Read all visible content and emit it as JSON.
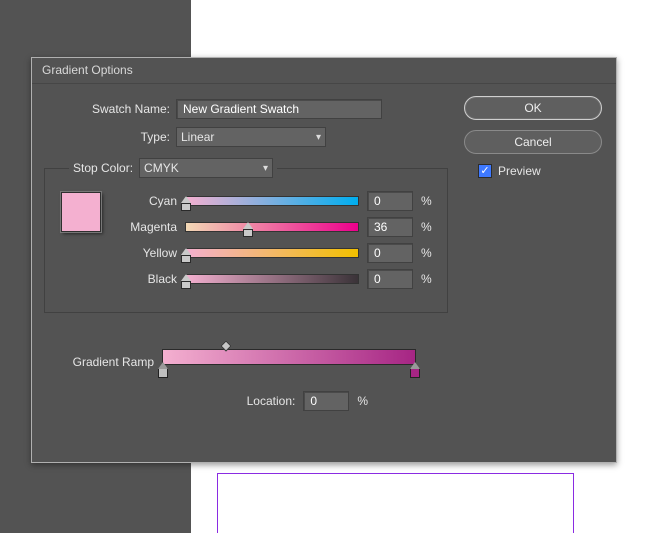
{
  "dialog": {
    "title": "Gradient Options",
    "swatch_name_label": "Swatch Name:",
    "swatch_name_value": "New Gradient Swatch",
    "type_label": "Type:",
    "type_value": "Linear",
    "stop_color_label": "Stop Color:",
    "stop_color_value": "CMYK",
    "sliders": {
      "cyan": {
        "label": "Cyan",
        "value": "0",
        "unit": "%",
        "thumb_pct": 0
      },
      "magenta": {
        "label": "Magenta",
        "value": "36",
        "unit": "%",
        "thumb_pct": 36
      },
      "yellow": {
        "label": "Yellow",
        "value": "0",
        "unit": "%",
        "thumb_pct": 0
      },
      "black": {
        "label": "Black",
        "value": "0",
        "unit": "%",
        "thumb_pct": 0
      }
    },
    "preview_swatch_color": "#f4b0d0",
    "ramp_label": "Gradient Ramp",
    "location_label": "Location:",
    "location_value": "0",
    "location_unit": "%"
  },
  "buttons": {
    "ok": "OK",
    "cancel": "Cancel",
    "preview_label": "Preview",
    "preview_checked": true
  }
}
